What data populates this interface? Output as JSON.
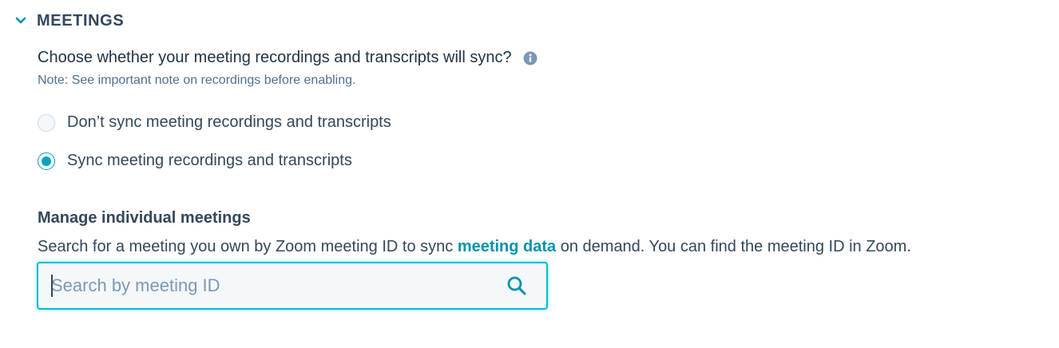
{
  "section": {
    "title": "MEETINGS",
    "expanded_icon": "chevron-down-icon"
  },
  "sync_setting": {
    "question": "Choose whether your meeting recordings and transcripts will sync?",
    "info_icon": "info-icon",
    "note": "Note: See important note on recordings before enabling.",
    "options": [
      {
        "label": "Don’t sync meeting recordings and transcripts",
        "selected": false
      },
      {
        "label": "Sync meeting recordings and transcripts",
        "selected": true
      }
    ]
  },
  "manage": {
    "title": "Manage individual meetings",
    "desc_before": "Search for a meeting you own by Zoom meeting ID to sync ",
    "desc_link": "meeting data",
    "desc_after": " on demand. You can find the meeting ID in Zoom."
  },
  "search": {
    "placeholder": "Search by meeting ID",
    "value": "",
    "icon": "search-icon"
  },
  "colors": {
    "accent": "#00a4bd",
    "link": "#0091ae",
    "text": "#33475b",
    "muted": "#516f90",
    "info_icon": "#7c98b6"
  }
}
